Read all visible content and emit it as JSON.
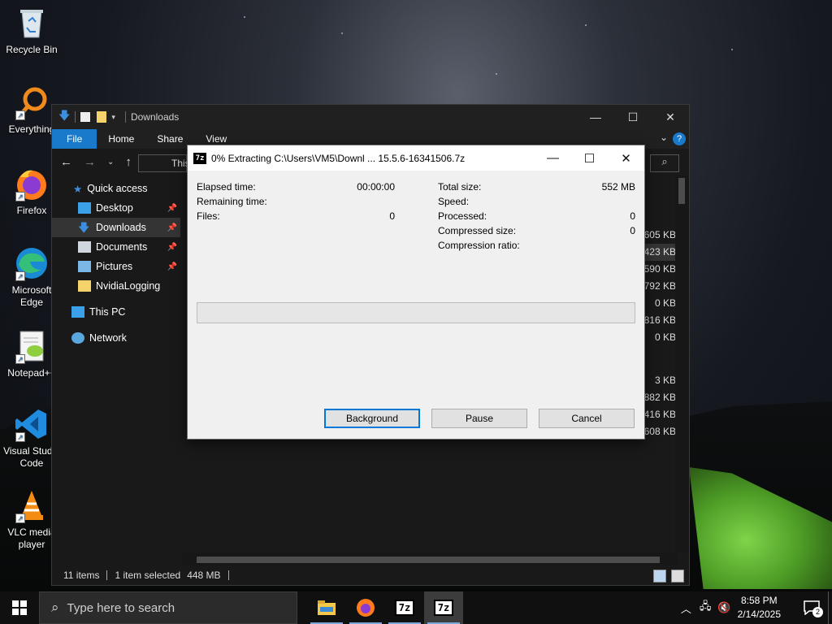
{
  "desktop": {
    "icons": [
      {
        "label": "Recycle Bin",
        "icon": "recycle-bin-icon"
      },
      {
        "label": "Everything",
        "icon": "everything-icon"
      },
      {
        "label": "Firefox",
        "icon": "firefox-icon"
      },
      {
        "label": "Microsoft Edge",
        "icon": "edge-icon"
      },
      {
        "label": "Notepad++",
        "icon": "notepad-plus-plus-icon"
      },
      {
        "label": "Visual Studio Code",
        "icon": "vscode-icon"
      },
      {
        "label": "VLC media player",
        "icon": "vlc-icon"
      }
    ]
  },
  "explorer": {
    "title": "Downloads",
    "ribbon_tabs": [
      "File",
      "Home",
      "Share",
      "View"
    ],
    "address_partial": "This",
    "nav": [
      {
        "label": "Quick access",
        "icon": "star-icon"
      },
      {
        "label": "Desktop",
        "icon": "desktop-folder-icon"
      },
      {
        "label": "Downloads",
        "icon": "downloads-folder-icon"
      },
      {
        "label": "Documents",
        "icon": "documents-folder-icon"
      },
      {
        "label": "Pictures",
        "icon": "pictures-folder-icon"
      },
      {
        "label": "NvidiaLogging",
        "icon": "folder-icon"
      },
      {
        "label": "This PC",
        "icon": "this-pc-icon"
      },
      {
        "label": "Network",
        "icon": "network-icon"
      }
    ],
    "sizes": [
      "605 KB",
      "423 KB",
      "590 KB",
      "792 KB",
      "0 KB",
      "816 KB",
      "0 KB",
      "",
      "3 KB",
      "882 KB",
      "416 KB",
      "608 KB"
    ],
    "status": {
      "items": "11 items",
      "selected": "1 item selected",
      "size": "448 MB"
    }
  },
  "dialog": {
    "title": "0% Extracting C:\\Users\\VM5\\Downl ... 15.5.6-16341506.7z",
    "icon_text": "7z",
    "progress": 0,
    "left_stats": [
      {
        "label": "Elapsed time:",
        "value": "00:00:00"
      },
      {
        "label": "Remaining time:",
        "value": ""
      },
      {
        "label": "Files:",
        "value": "0"
      }
    ],
    "right_stats": [
      {
        "label": "Total size:",
        "value": "552 MB"
      },
      {
        "label": "Speed:",
        "value": ""
      },
      {
        "label": "Processed:",
        "value": "0"
      },
      {
        "label": "Compressed size:",
        "value": "0"
      },
      {
        "label": "Compression ratio:",
        "value": ""
      }
    ],
    "buttons": {
      "background": "Background",
      "pause": "Pause",
      "cancel": "Cancel"
    }
  },
  "taskbar": {
    "search_placeholder": "Type here to search",
    "apps": [
      "file-explorer-icon",
      "firefox-icon",
      "7zip-icon",
      "7zip-icon"
    ],
    "time": "8:58 PM",
    "date": "2/14/2025",
    "notifications": "2"
  }
}
